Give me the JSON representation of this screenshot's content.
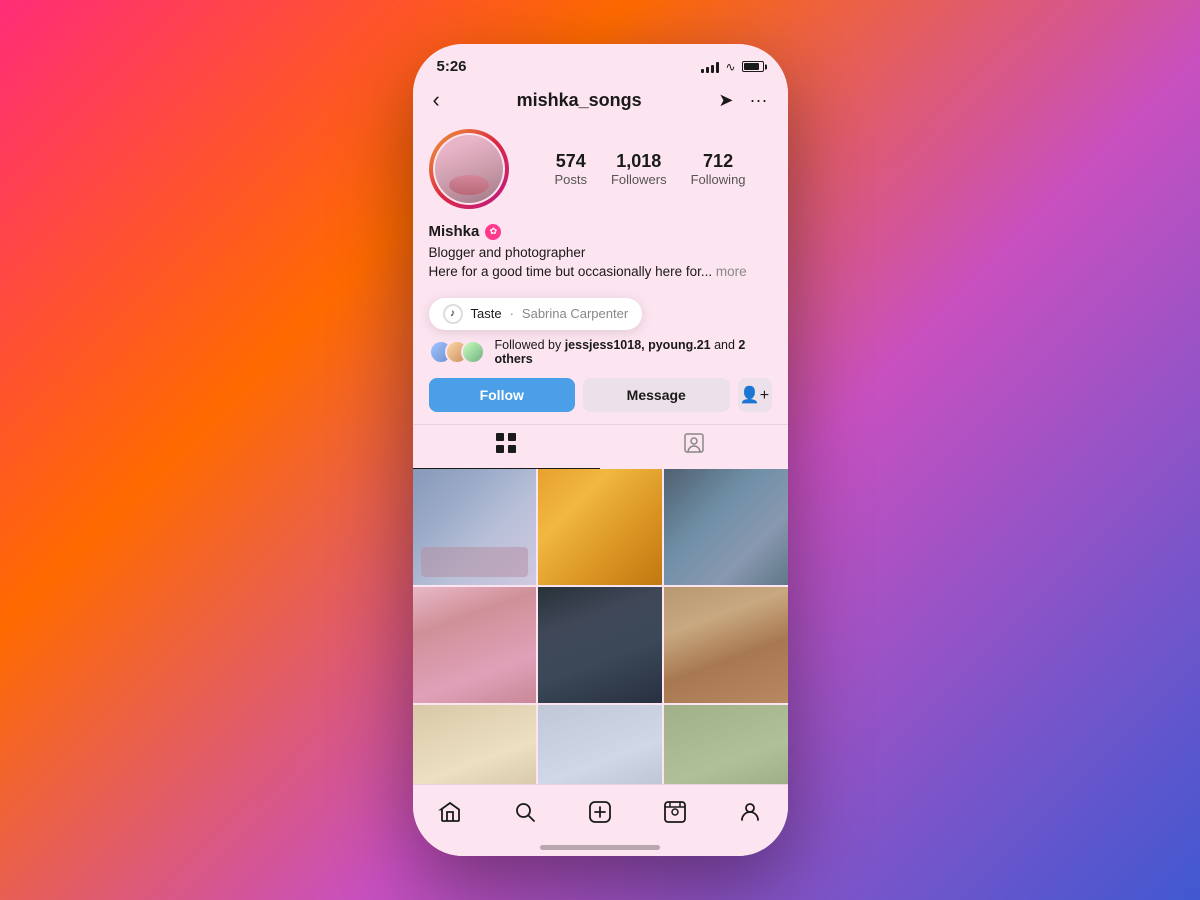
{
  "background": {
    "gradient": "linear-gradient(135deg, #ff2d78 0%, #ff6a00 30%, #c850c0 60%, #4158d0 100%)"
  },
  "statusBar": {
    "time": "5:26",
    "batteryLevel": 85
  },
  "navBar": {
    "username": "mishka_songs",
    "backLabel": "‹",
    "directIcon": "send",
    "moreIcon": "···"
  },
  "profile": {
    "name": "Mishka",
    "isVerified": true,
    "bio_line1": "Blogger and photographer",
    "bio_line2": "Here for a good time but occasionally here for...",
    "bio_more": "more",
    "stats": {
      "posts": {
        "count": "574",
        "label": "Posts"
      },
      "followers": {
        "count": "1,018",
        "label": "Followers"
      },
      "following": {
        "count": "712",
        "label": "Following"
      }
    },
    "followedBy": {
      "text_pre": "Followed by ",
      "names": "jessjess1018, pyoung.21",
      "text_post": " and ",
      "others": "2 others"
    },
    "music": {
      "song": "Taste",
      "artist": "Sabrina Carpenter"
    }
  },
  "buttons": {
    "follow": "Follow",
    "message": "Message",
    "addFriend": "+"
  },
  "tabs": {
    "grid": "⊞",
    "tagged": "👤"
  },
  "bottomNav": {
    "home": "⌂",
    "search": "⌕",
    "add": "⊕",
    "reels": "▶",
    "profile": "◉"
  },
  "grid": {
    "rows": [
      [
        "post-1",
        "post-2",
        "post-3"
      ],
      [
        "post-4",
        "post-5",
        "post-6"
      ],
      [
        "post-7",
        "post-7",
        "post-7"
      ]
    ]
  },
  "colors": {
    "followBtn": "#4a9fe8",
    "verified": "#ff3a8c",
    "profileBg": "#fce4f0"
  }
}
